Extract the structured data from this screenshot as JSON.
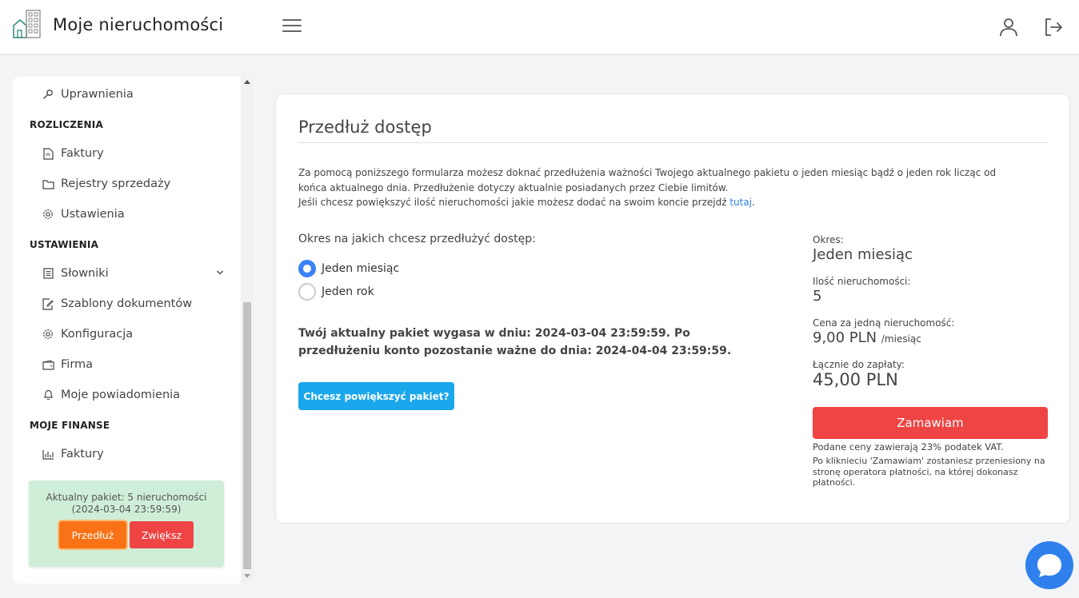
{
  "header": {
    "title": "Moje nieruchomości",
    "icons": [
      "building-logo-icon",
      "hamburger-icon",
      "user-icon",
      "logout-icon"
    ]
  },
  "sidebar": {
    "items_top": [
      {
        "label": "Uprawnienia",
        "icon": "key-icon"
      }
    ],
    "sections": [
      {
        "title": "ROZLICZENIA",
        "items": [
          {
            "label": "Faktury",
            "icon": "pdf-file-icon"
          },
          {
            "label": "Rejestry sprzedaży",
            "icon": "folder-icon"
          },
          {
            "label": "Ustawienia",
            "icon": "gear-icon"
          }
        ]
      },
      {
        "title": "USTAWIENIA",
        "items": [
          {
            "label": "Słowniki",
            "icon": "list-icon"
          },
          {
            "label": "Szablony dokumentów",
            "icon": "document-edit-icon"
          },
          {
            "label": "Konfiguracja",
            "icon": "gear-icon"
          },
          {
            "label": "Firma",
            "icon": "wallet-icon"
          },
          {
            "label": "Moje powiadomienia",
            "icon": "bell-icon"
          }
        ]
      },
      {
        "title": "MOJE FINANSE",
        "items": [
          {
            "label": "Faktury",
            "icon": "bar-chart-icon"
          }
        ]
      }
    ],
    "package": {
      "line1": "Aktualny pakiet: 5 nieruchomości",
      "line2": "(2024-03-04 23:59:59)",
      "extend_label": "Przedłuż",
      "increase_label": "Zwiększ"
    }
  },
  "main": {
    "title": "Przedłuż dostęp",
    "desc_line1": "Za pomocą poniższego formularza możesz doknać przedłużenia ważności Twojego aktualnego pakietu o jeden miesiąc bądź o jeden rok licząc od końca aktualnego dnia. Przedłużenie dotyczy aktualnie posiadanych przez Ciebie limitów.",
    "desc_line2_prefix": "Jeśli chcesz powiększyć ilość nieruchomości jakie możesz dodać na swoim koncie przejdź ",
    "desc_link": "tutaj",
    "desc_line2_suffix": ".",
    "period_question": "Okres na jakich chcesz przedłużyć dostęp:",
    "options": [
      {
        "label": "Jeden miesiąc",
        "checked": true
      },
      {
        "label": "Jeden rok",
        "checked": false
      }
    ],
    "expire_text": "Twój aktualny pakiet wygasa w dniu: 2024-03-04 23:59:59. Po przedłużeniu konto pozostanie ważne do dnia: 2024-04-04 23:59:59.",
    "enlarge_button": "Chcesz powiększyć pakiet?",
    "summary": {
      "period_label": "Okres:",
      "period_value": "Jeden miesiąc",
      "count_label": "Ilość nieruchomości:",
      "count_value": "5",
      "price_label": "Cena za jedną nieruchomość:",
      "price_value": "9,00 PLN",
      "price_unit": "/miesiąc",
      "total_label": "Łącznie do zapłaty:",
      "total_value": "45,00 PLN",
      "order_button": "Zamawiam",
      "vat_note": "Podane ceny zawierają 23% podatek VAT.",
      "redirect_note": "Po kliknieciu 'Zamawiam' zostaniesz przeniesiony na stronę operatora płatności, na której dokonasz płatności."
    }
  },
  "colors": {
    "accent_blue": "#3b82f6",
    "order_red": "#ef4444",
    "extend_orange": "#f97316",
    "package_green": "#cfeed7",
    "enlarge_blue": "#1aa7ec",
    "chat_blue": "#2f80ed"
  }
}
